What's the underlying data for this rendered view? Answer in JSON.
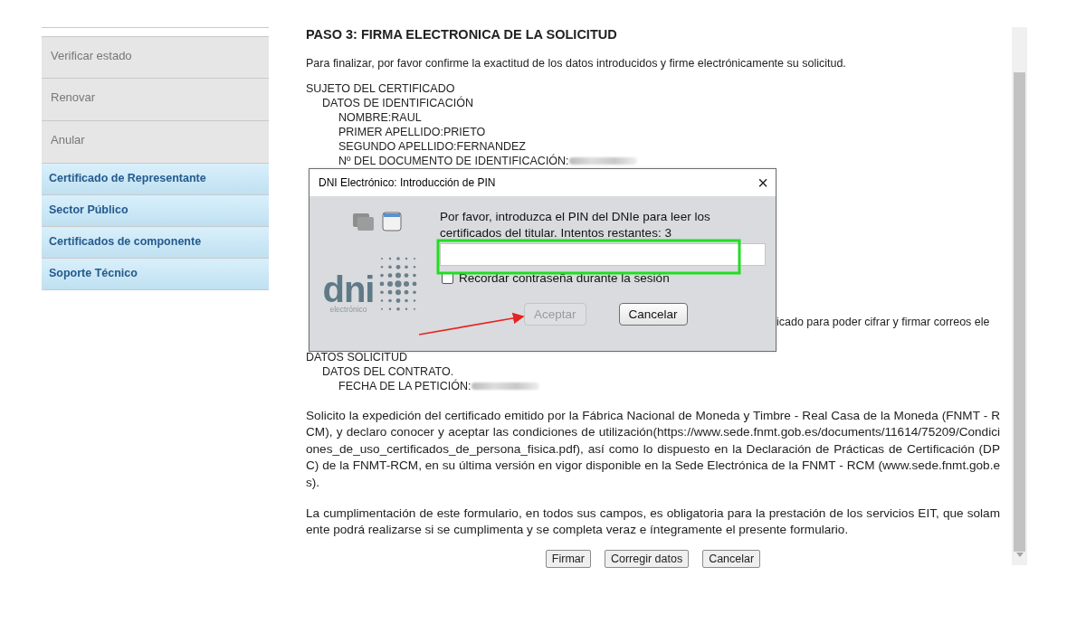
{
  "sidebar": {
    "items": [
      {
        "label": "Verificar estado",
        "kind": "plain"
      },
      {
        "label": "Renovar",
        "kind": "plain"
      },
      {
        "label": "Anular",
        "kind": "plain"
      },
      {
        "label": "Certificado de Representante",
        "kind": "section"
      },
      {
        "label": "Sector Público",
        "kind": "section"
      },
      {
        "label": "Certificados de componente",
        "kind": "section"
      },
      {
        "label": "Soporte Técnico",
        "kind": "section"
      }
    ]
  },
  "main": {
    "title": "PASO 3: FIRMA ELECTRONICA DE LA SOLICITUD",
    "intro": "Para finalizar, por favor confirme la exactitud de los datos introducidos y firme electrónicamente su solicitud.",
    "summary_top": [
      {
        "text": "SUJETO DEL CERTIFICADO",
        "kind": "line",
        "children": [
          {
            "text": "DATOS DE IDENTIFICACIÓN",
            "kind": "line",
            "children": [
              {
                "text": "NOMBRE:RAUL",
                "kind": "line"
              },
              {
                "text": "PRIMER APELLIDO:PRIETO",
                "kind": "line"
              },
              {
                "text": "SEGUNDO APELLIDO:FERNANDEZ",
                "kind": "line"
              },
              {
                "text": "Nº DEL DOCUMENTO DE IDENTIFICACIÓN:",
                "kind": "redacted"
              }
            ]
          }
        ]
      }
    ],
    "partial_line": "icado para poder cifrar y firmar correos ele",
    "summary_bottom": [
      {
        "text": "DATOS SOLICITUD",
        "kind": "line",
        "children": [
          {
            "text": "DATOS DEL CONTRATO.",
            "kind": "line",
            "children": [
              {
                "text": "FECHA DE LA PETICIÓN:",
                "kind": "redacted"
              }
            ]
          }
        ]
      }
    ],
    "paragraphs": [
      "Solicito la expedición del certificado emitido por la Fábrica Nacional de Moneda y Timbre - Real Casa de la Moneda (FNMT - RCM), y declaro conocer y aceptar las condiciones de utilización(https://www.sede.fnmt.gob.es/documents/11614/75209/Condiciones_de_uso_certificados_de_persona_fisica.pdf), así como lo dispuesto en la Declaración de Prácticas de Certificación (DPC) de la FNMT-RCM, en su última versión en vigor disponible en la Sede Electrónica de la FNMT - RCM (www.sede.fnmt.gob.es).",
      "La cumplimentación de este formulario, en todos sus campos, es obligatoria para la prestación de los servicios EIT, que solamente podrá realizarse si se cumplimenta y se completa veraz e íntegramente el presente formulario."
    ],
    "buttons": [
      "Firmar",
      "Corregir datos",
      "Cancelar"
    ]
  },
  "dialog": {
    "title": "DNI Electrónico: Introducción de PIN",
    "close": "×",
    "logo_text": "dni",
    "logo_subtext": "electrónico",
    "message": "Por favor, introduzca el PIN del DNIe para leer los certificados del titular. Intentos restantes: 3",
    "remember": {
      "label": "Recordar contraseña durante la sesión",
      "checked": false
    },
    "buttons": [
      {
        "label": "Aceptar",
        "disabled": true
      },
      {
        "label": "Cancelar",
        "disabled": false
      }
    ]
  }
}
